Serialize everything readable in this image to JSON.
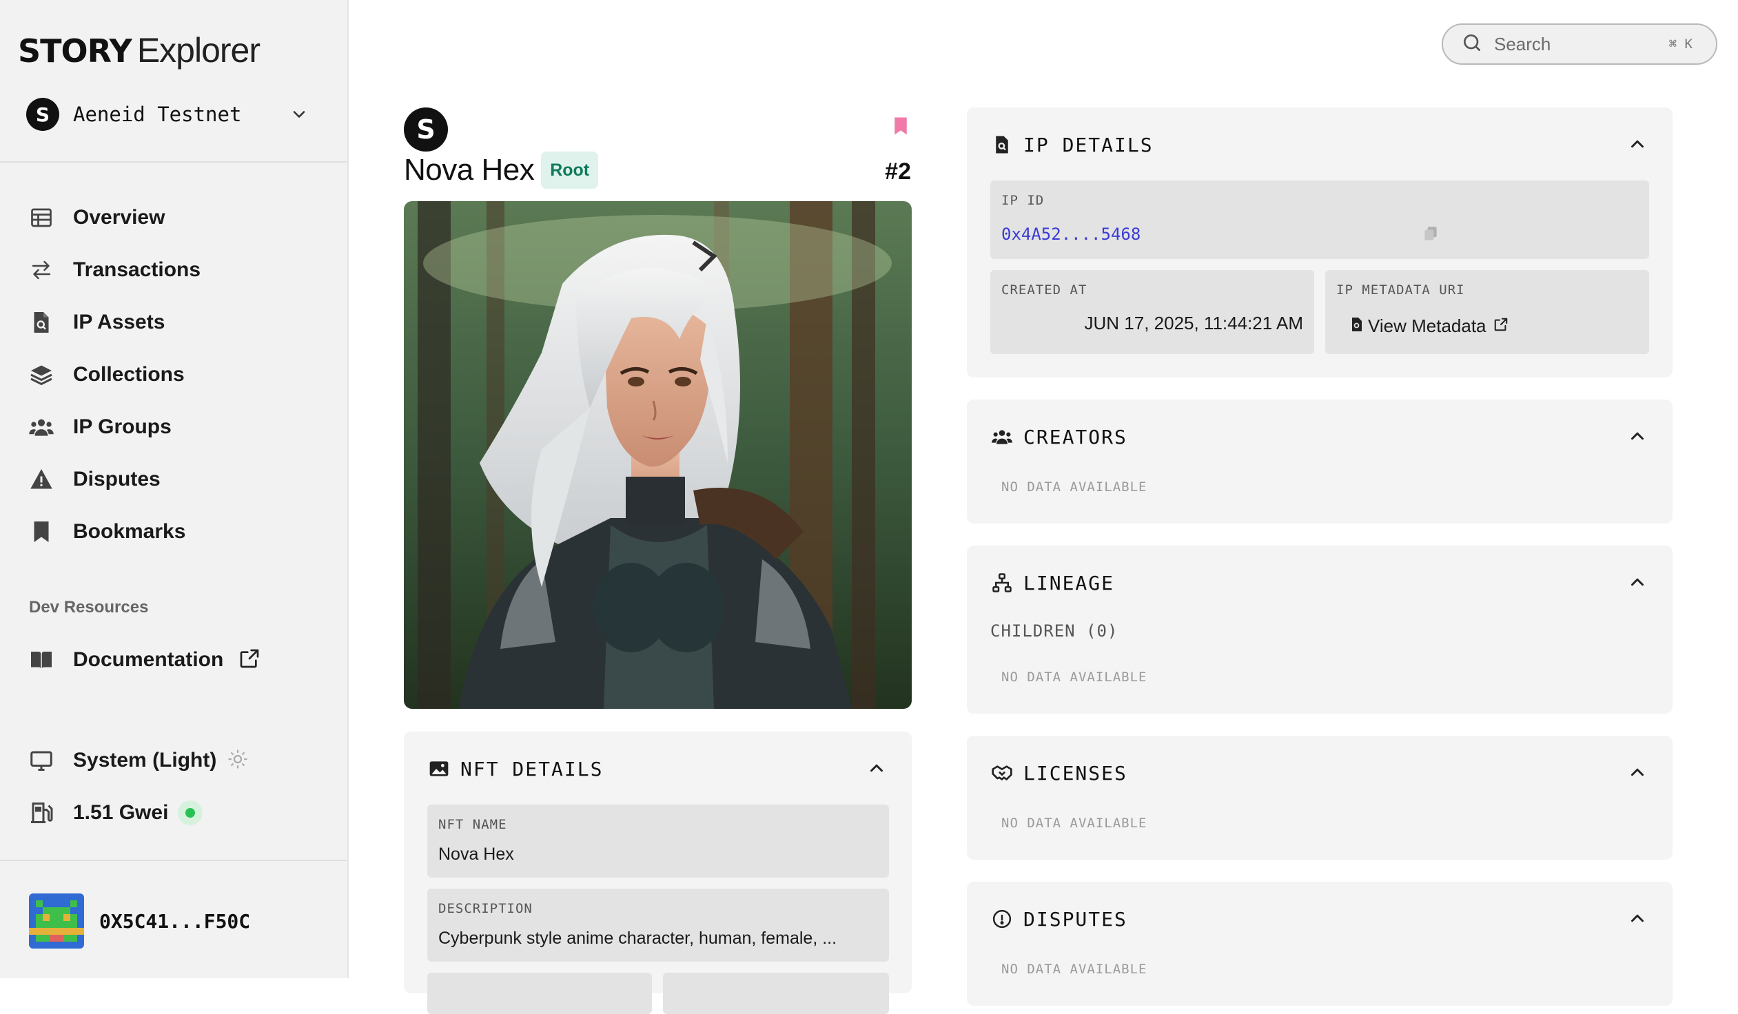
{
  "brand": {
    "story": "STORY",
    "explorer": "Explorer"
  },
  "network": {
    "name": "Aeneid Testnet",
    "logo_letter": "S"
  },
  "nav": {
    "items": [
      {
        "label": "Overview",
        "icon": "table-icon"
      },
      {
        "label": "Transactions",
        "icon": "swap-arrows-icon"
      },
      {
        "label": "IP Assets",
        "icon": "file-search-icon"
      },
      {
        "label": "Collections",
        "icon": "layers-icon"
      },
      {
        "label": "IP Groups",
        "icon": "users-icon"
      },
      {
        "label": "Disputes",
        "icon": "warning-icon"
      },
      {
        "label": "Bookmarks",
        "icon": "bookmark-icon"
      }
    ]
  },
  "dev_resources": {
    "heading": "Dev Resources",
    "documentation": "Documentation"
  },
  "system": {
    "theme_label": "System (Light)",
    "gas_label": "1.51 Gwei"
  },
  "wallet": {
    "address": "0X5C41...F50C"
  },
  "search": {
    "placeholder": "Search",
    "shortcut": "⌘ K"
  },
  "asset": {
    "logo_letter": "S",
    "name": "Nova Hex",
    "badge": "Root",
    "number": "#2"
  },
  "nft_details": {
    "title": "NFT DETAILS",
    "nft_name_label": "NFT NAME",
    "nft_name": "Nova Hex",
    "description_label": "DESCRIPTION",
    "description": "Cyberpunk style anime character, human, female, ..."
  },
  "ip_details": {
    "title": "IP DETAILS",
    "ip_id_label": "IP ID",
    "ip_id": "0x4A52....5468",
    "created_label": "CREATED AT",
    "created_at": "JUN 17, 2025, 11:44:21 AM",
    "metadata_label": "IP METADATA URI",
    "metadata_link": "View Metadata"
  },
  "creators": {
    "title": "CREATORS",
    "empty": "NO DATA AVAILABLE"
  },
  "lineage": {
    "title": "LINEAGE",
    "children_label": "CHILDREN (0)",
    "empty": "NO DATA AVAILABLE"
  },
  "licenses": {
    "title": "LICENSES",
    "empty": "NO DATA AVAILABLE"
  },
  "disputes": {
    "title": "DISPUTES",
    "empty": "NO DATA AVAILABLE"
  },
  "colors": {
    "accent_link": "#3b3bd6",
    "root_badge_bg": "#dff2ec",
    "root_badge_text": "#0f7a5c",
    "bookmark": "#f07aa8",
    "gas_status": "#27c251"
  }
}
